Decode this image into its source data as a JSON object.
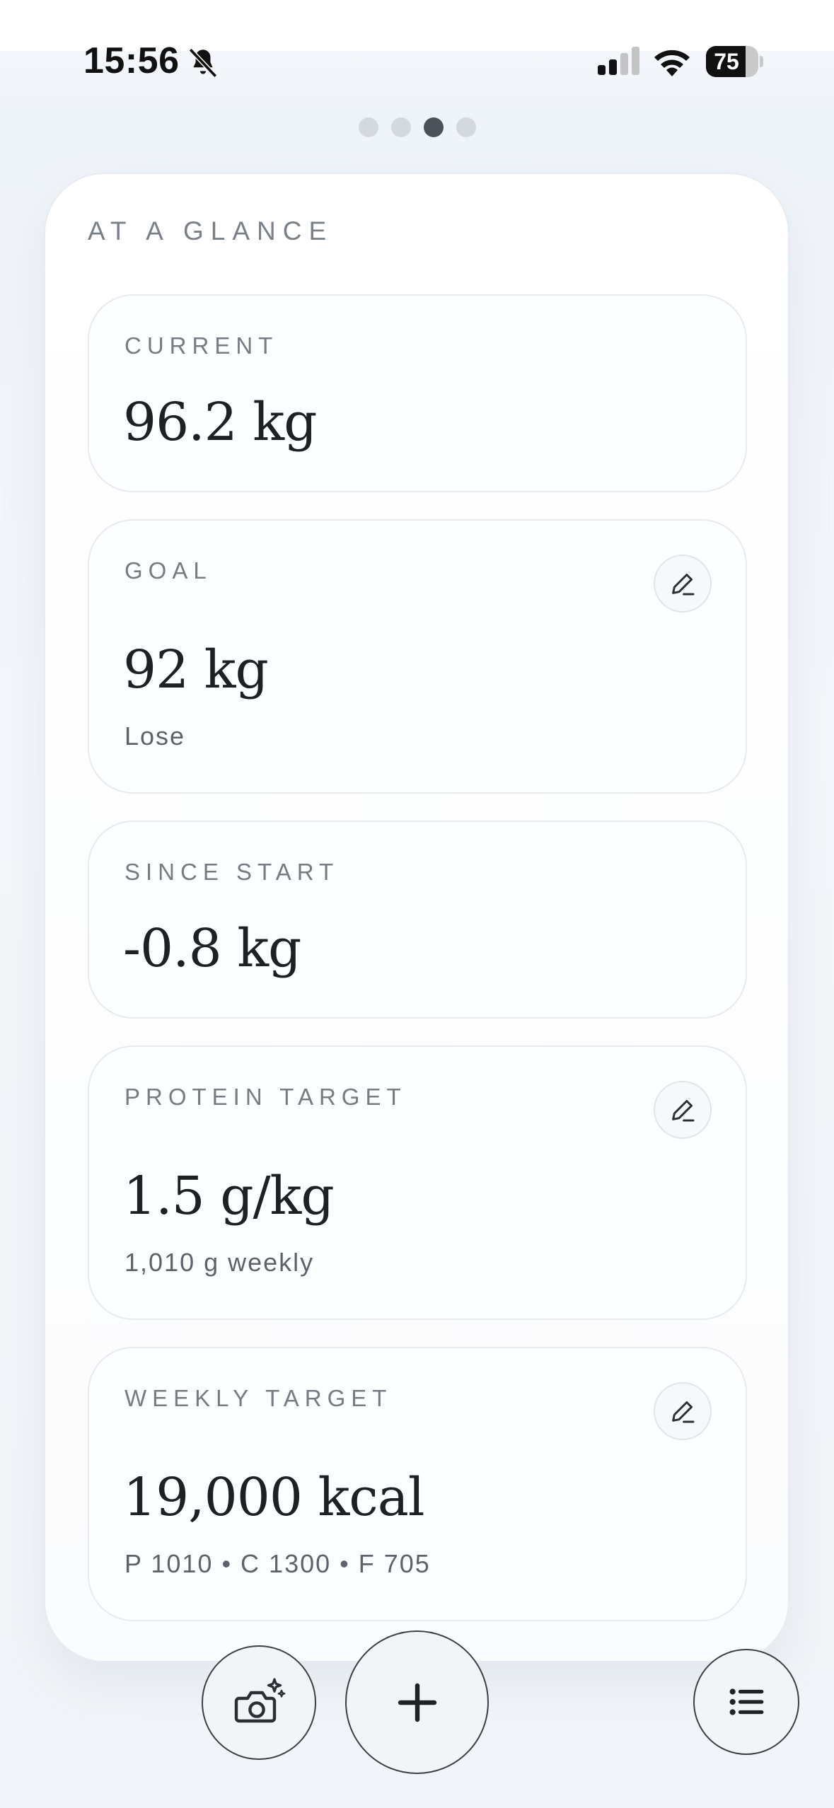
{
  "status_bar": {
    "time": "15:56",
    "battery": "75",
    "battery_level": 0.75,
    "icons": [
      "bell-slash-icon",
      "cellular-signal-icon",
      "wifi-icon",
      "battery-icon"
    ]
  },
  "pager": {
    "count": 4,
    "active_index": 2
  },
  "glance": {
    "section_label": "AT A GLANCE",
    "current": {
      "label": "CURRENT",
      "value": "96.2 kg"
    },
    "goal": {
      "label": "GOAL",
      "value": "92 kg",
      "sub": "Lose"
    },
    "since_start": {
      "label": "SINCE START",
      "value": "-0.8 kg"
    },
    "protein": {
      "label": "PROTEIN TARGET",
      "value": "1.5 g/kg",
      "sub": "1,010 g weekly"
    },
    "weekly": {
      "label": "WEEKLY TARGET",
      "value": "19,000 kcal",
      "sub": "P 1010 • C 1300 • F 705"
    }
  },
  "actions": {
    "icons": [
      "camera-sparkle-icon",
      "plus-icon",
      "list-icon"
    ]
  }
}
